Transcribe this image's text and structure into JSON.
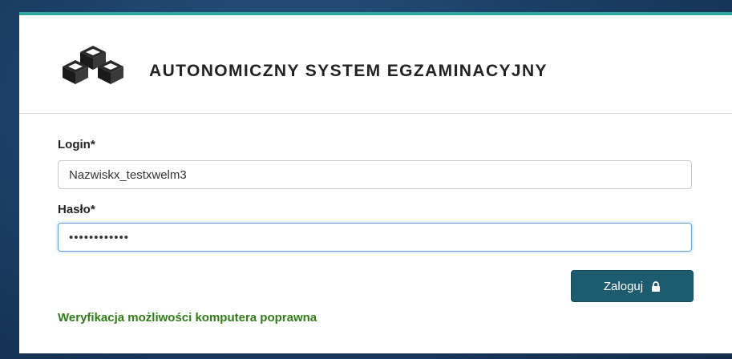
{
  "header": {
    "title": "AUTONOMICZNY SYSTEM EGZAMINACYJNY",
    "logo_icon": "cubes-icon"
  },
  "form": {
    "login_label": "Login*",
    "login_value": "Nazwiskx_testxwelm3",
    "password_label": "Hasło*",
    "password_value": "••••••••••••"
  },
  "submit": {
    "label": "Zaloguj",
    "icon": "lock-icon"
  },
  "status_message": "Weryfikacja możliwości komputera poprawna",
  "colors": {
    "accent_bar": "#2fa7a0",
    "button": "#1d5c6e",
    "status_text": "#2f7d16",
    "focus_border": "#66a3dc"
  }
}
